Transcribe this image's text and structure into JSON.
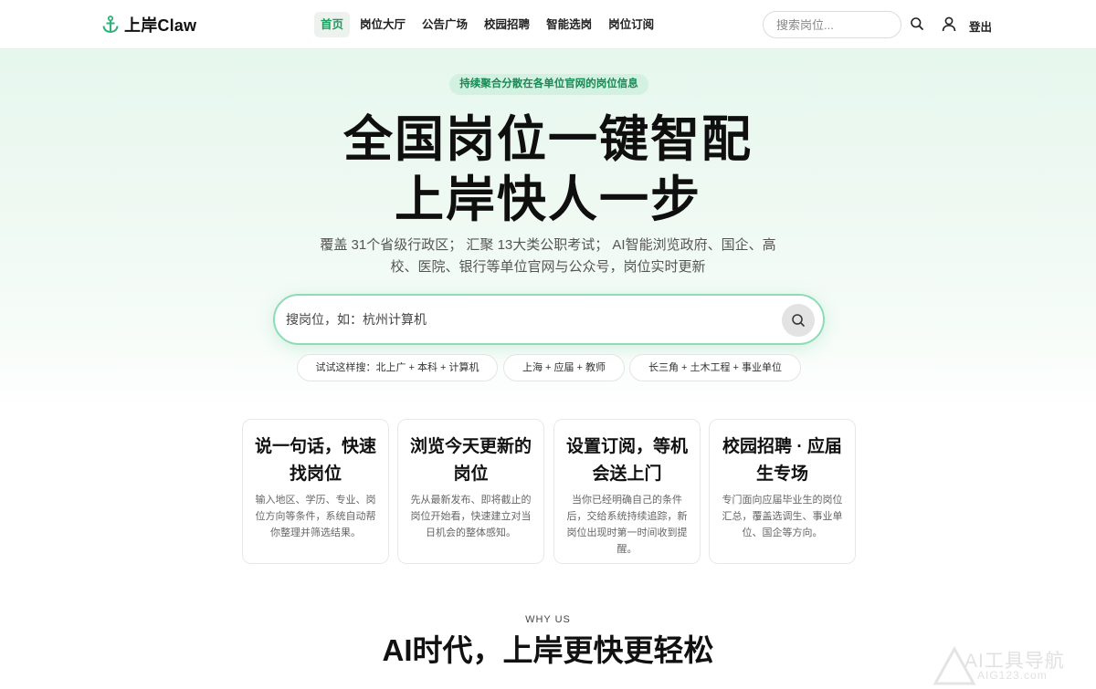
{
  "brand": {
    "name": "上岸Claw",
    "accent": "#1d9e60"
  },
  "nav": {
    "items": [
      {
        "label": "首页",
        "active": true
      },
      {
        "label": "岗位大厅",
        "active": false
      },
      {
        "label": "公告广场",
        "active": false
      },
      {
        "label": "校园招聘",
        "active": false
      },
      {
        "label": "智能选岗",
        "active": false
      },
      {
        "label": "岗位订阅",
        "active": false
      }
    ]
  },
  "header": {
    "search_placeholder": "搜索岗位...",
    "search_icon": "search-icon",
    "user_icon": "user-icon",
    "logout_label": "登出"
  },
  "hero": {
    "badge": "持续聚合分散在各单位官网的岗位信息",
    "title_line1": "全国岗位一键智配",
    "title_line2": "上岸快人一步",
    "subtitle_line1": "覆盖 31个省级行政区； 汇聚 13大类公职考试； AI智能浏览政府、国企、高",
    "subtitle_line2": "校、医院、银行等单位官网与公众号，岗位实时更新",
    "search_placeholder": "搜岗位，如：杭州计算机",
    "chips": [
      "试试这样搜：北上广 + 本科 + 计算机",
      "上海 + 应届 + 教师",
      "长三角 + 土木工程 + 事业单位"
    ]
  },
  "features": [
    {
      "title": "说一句话，快速找岗位",
      "desc": "输入地区、学历、专业、岗位方向等条件，系统自动帮你整理并筛选结果。"
    },
    {
      "title": "浏览今天更新的岗位",
      "desc": "先从最新发布、即将截止的岗位开始看，快速建立对当日机会的整体感知。"
    },
    {
      "title": "设置订阅，等机会送上门",
      "desc": "当你已经明确自己的条件后，交给系统持续追踪，新岗位出现时第一时间收到提醒。"
    },
    {
      "title": "校园招聘 · 应届生专场",
      "desc": "专门面向应届毕业生的岗位汇总，覆盖选调生、事业单位、国企等方向。"
    }
  ],
  "why": {
    "eyebrow": "WHY US",
    "title": "AI时代，上岸更快更轻松"
  },
  "watermark": {
    "line1": "AI工具导航",
    "line2": "AIG123.com"
  }
}
